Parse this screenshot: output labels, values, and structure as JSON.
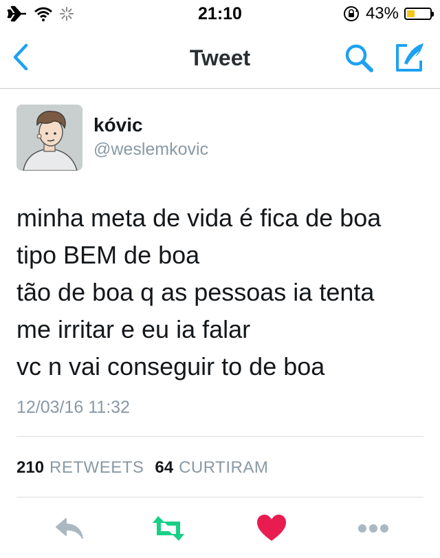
{
  "status_bar": {
    "time": "21:10",
    "battery_percent": "43%",
    "battery_level": 0.43,
    "battery_color": "#f5c518",
    "icons": [
      "airplane-icon",
      "wifi-icon",
      "activity-spinner-icon",
      "rotation-lock-icon",
      "battery-icon"
    ]
  },
  "nav": {
    "title": "Tweet",
    "accent_color": "#1da1f2",
    "icons": [
      "back-chevron-icon",
      "search-icon",
      "compose-icon"
    ]
  },
  "tweet": {
    "author_name": "kóvic",
    "author_handle": "@weslemkovic",
    "text": "minha meta de vida é fica de boa\ntipo BEM de boa\ntão de boa q as pessoas ia tenta\nme irritar e eu ia falar\nvc n vai conseguir to de boa",
    "timestamp": "12/03/16 11:32",
    "retweets_count": "210",
    "retweets_label": "RETWEETS",
    "likes_count": "64",
    "likes_label": "CURTIRAM"
  },
  "actions": {
    "icons": [
      "reply-icon",
      "retweet-icon",
      "like-heart-icon",
      "more-dots-icon"
    ],
    "retweet_color": "#19cf86",
    "like_color": "#e81c4f",
    "neutral_color": "#aab8c2"
  }
}
